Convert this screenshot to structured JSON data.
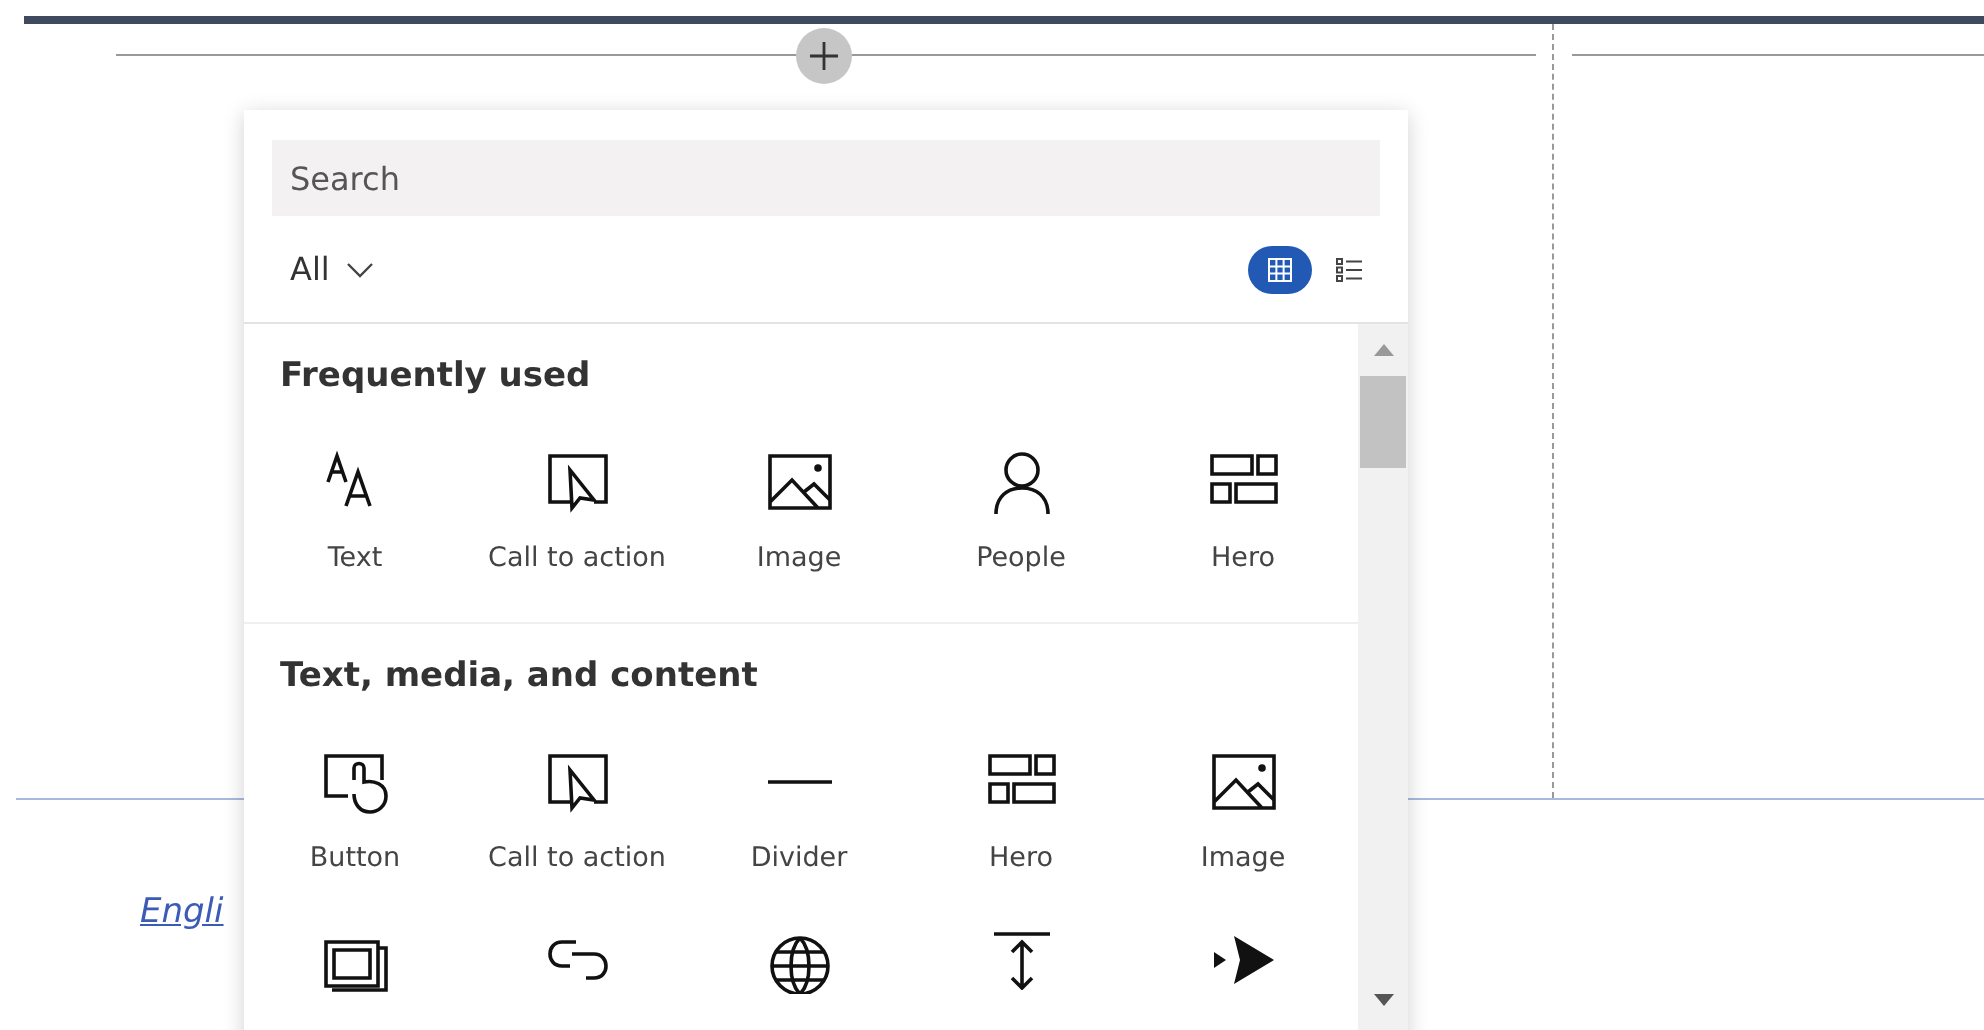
{
  "toolbox": {
    "search": {
      "placeholder": "Search"
    },
    "filter": {
      "label": "All"
    },
    "views": [
      {
        "kind": "grid",
        "selected": true
      },
      {
        "kind": "list",
        "selected": false
      }
    ],
    "sections": [
      {
        "title": "Frequently used",
        "items": [
          {
            "kind": "text",
            "label": "Text"
          },
          {
            "kind": "cta",
            "label": "Call to action"
          },
          {
            "kind": "image",
            "label": "Image"
          },
          {
            "kind": "people",
            "label": "People"
          },
          {
            "kind": "hero",
            "label": "Hero"
          }
        ]
      },
      {
        "title": "Text, media, and content",
        "items": [
          {
            "kind": "button",
            "label": "Button"
          },
          {
            "kind": "cta",
            "label": "Call to action"
          },
          {
            "kind": "divider",
            "label": "Divider"
          },
          {
            "kind": "hero",
            "label": "Hero"
          },
          {
            "kind": "image",
            "label": "Image"
          },
          {
            "kind": "stack"
          },
          {
            "kind": "link"
          },
          {
            "kind": "globe"
          },
          {
            "kind": "spacer"
          },
          {
            "kind": "stream"
          }
        ]
      }
    ]
  },
  "page": {
    "link": "Engli"
  }
}
